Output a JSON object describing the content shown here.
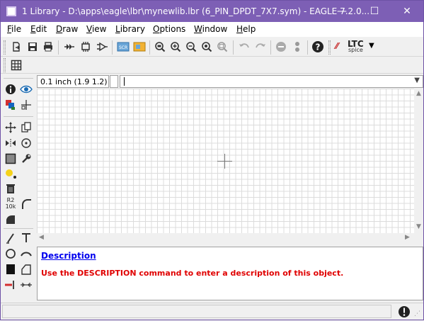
{
  "window": {
    "title": "1 Library - D:\\apps\\eagle\\lbr\\mynewlib.lbr (6_PIN_DPDT_7X7.sym) - EAGLE 7.2.0...",
    "controls": {
      "minimize": "—",
      "maximize": "☐",
      "close": "✕"
    }
  },
  "menu": {
    "items": [
      {
        "label": "File",
        "accel": "F",
        "rest": "ile"
      },
      {
        "label": "Edit",
        "accel": "E",
        "rest": "dit"
      },
      {
        "label": "Draw",
        "accel": "D",
        "rest": "raw"
      },
      {
        "label": "View",
        "accel": "V",
        "rest": "iew"
      },
      {
        "label": "Library",
        "accel": "L",
        "rest": "ibrary"
      },
      {
        "label": "Options",
        "accel": "O",
        "rest": "ptions"
      },
      {
        "label": "Window",
        "accel": "W",
        "rest": "indow"
      },
      {
        "label": "Help",
        "accel": "H",
        "rest": "elp"
      }
    ]
  },
  "toolbar": {
    "ltc_label": "LTC",
    "spice_label": "spice"
  },
  "coords": {
    "grid_readout": "0.1 inch (1.9 1.2)",
    "command_value": ""
  },
  "description": {
    "link": "Description",
    "text": "Use the DESCRIPTION command to enter a description of this object."
  },
  "left_tools": {
    "resistor_label_top": "R2",
    "resistor_label_bottom": "10k"
  },
  "colors": {
    "titlebar": "#7d5fb5",
    "link": "#0000ee",
    "warning_text": "#e00000",
    "grid_line": "#dcdcdc"
  }
}
